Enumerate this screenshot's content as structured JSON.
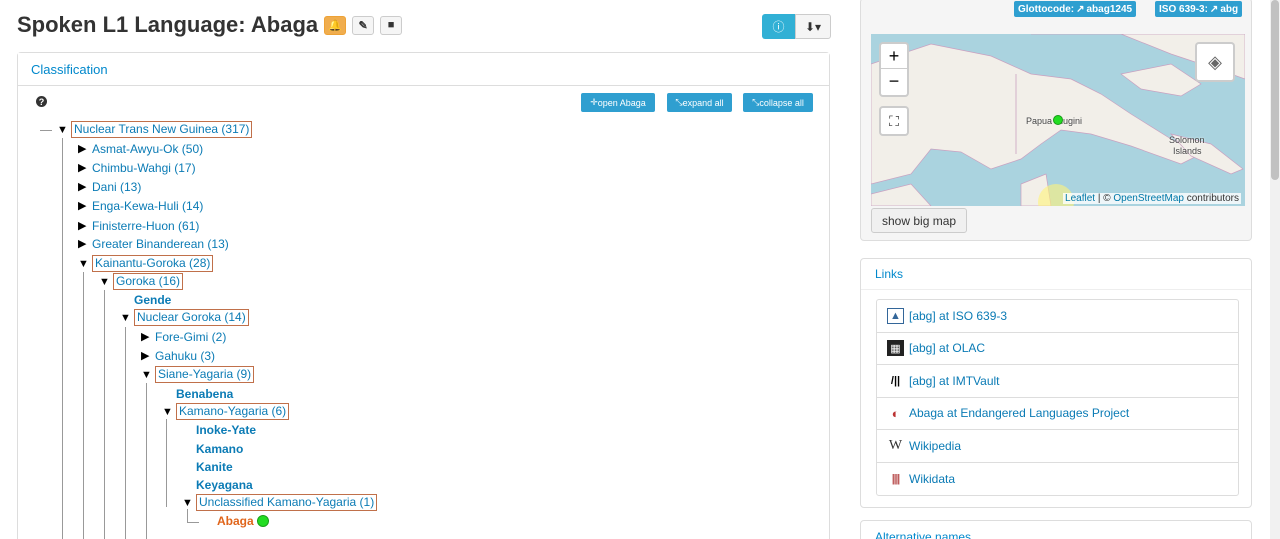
{
  "header": {
    "title": "Spoken L1 Language: Abaga"
  },
  "classification": {
    "heading": "Classification",
    "buttons": {
      "open": "open Abaga",
      "expand": "expand all",
      "collapse": "collapse all"
    },
    "tree": {
      "root": "Nuclear Trans New Guinea (317)",
      "n1": "Asmat-Awyu-Ok (50)",
      "n2": "Chimbu-Wahgi (17)",
      "n3": "Dani (13)",
      "n4": "Enga-Kewa-Huli (14)",
      "n5": "Finisterre-Huon (61)",
      "n6": "Greater Binanderean (13)",
      "n7": "Kainantu-Goroka (28)",
      "n8": "Goroka (16)",
      "n9": "Gende",
      "n10": "Nuclear Goroka (14)",
      "n11": "Fore-Gimi (2)",
      "n12": "Gahuku (3)",
      "n13": "Siane-Yagaria (9)",
      "n14": "Benabena",
      "n15": "Kamano-Yagaria (6)",
      "n16": "Inoke-Yate",
      "n17": "Kamano",
      "n18": "Kanite",
      "n19": "Keyagana",
      "n20": "Unclassified Kamano-Yagaria (1)",
      "n21": "Abaga"
    }
  },
  "map": {
    "glottocode_label": "Glottocode:",
    "glottocode": "abag1245",
    "iso_label": "ISO 639-3:",
    "iso": "abg",
    "label_png": "Papua Niugini",
    "label_solomon1": "Solomon",
    "label_solomon2": "Islands",
    "attrib_leaflet": "Leaflet",
    "attrib_sep": " | © ",
    "attrib_osm": "OpenStreetMap",
    "attrib_contrib": " contributors",
    "big_map_button": "show big map"
  },
  "links": {
    "heading": "Links",
    "items": [
      {
        "label": "[abg] at ISO 639-3"
      },
      {
        "label": "[abg] at OLAC"
      },
      {
        "label": "[abg] at IMTVault"
      },
      {
        "label": "Abaga at Endangered Languages Project"
      },
      {
        "label": "Wikipedia"
      },
      {
        "label": "Wikidata"
      }
    ]
  },
  "alt_names": {
    "heading": "Alternative names"
  },
  "colors": {
    "link": "#0b7bb5",
    "accent": "#2f9fd0",
    "current": "#e0651b",
    "warn": "#f0ad4e"
  }
}
